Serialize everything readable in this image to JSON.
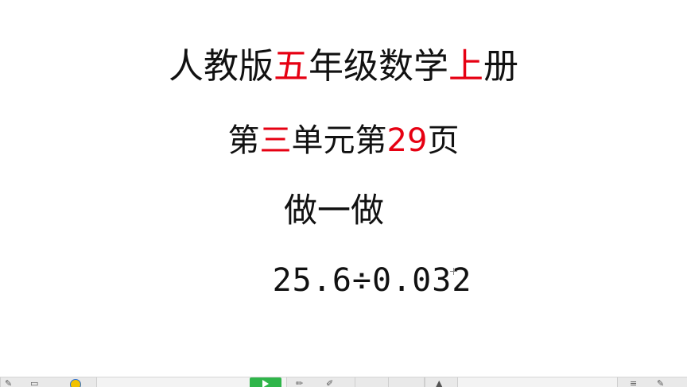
{
  "slide": {
    "title": {
      "p1": "人教版",
      "p2": "五",
      "p3": "年级数学",
      "p4": "上",
      "p5": "册"
    },
    "subtitle": {
      "p1": "第",
      "p2": "三",
      "p3": "单元第",
      "p4": "29",
      "p5": "页"
    },
    "section": "做一做",
    "problem": "25.6÷0.032",
    "highlight_color": "#e60012",
    "text_color": "#111111"
  },
  "taskbar": {
    "icons": [
      "pen-icon",
      "eraser-icon",
      "user-icon",
      "play-icon",
      "pencil-icon",
      "marker-icon",
      "pointer-icon",
      "menu-icon"
    ],
    "accent": "#2fb54a"
  }
}
